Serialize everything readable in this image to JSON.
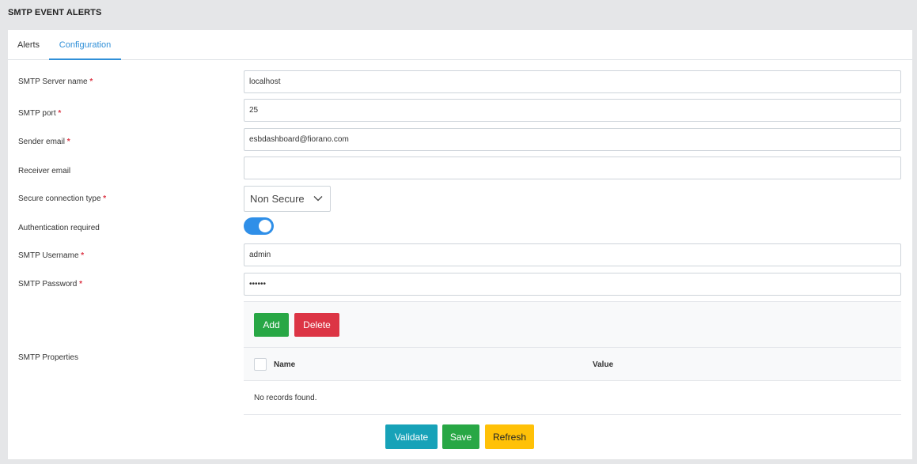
{
  "page": {
    "title": "SMTP EVENT ALERTS"
  },
  "tabs": [
    {
      "label": "Alerts",
      "active": false
    },
    {
      "label": "Configuration",
      "active": true
    }
  ],
  "form": {
    "server_name": {
      "label": "SMTP Server name",
      "value": "localhost",
      "required": true
    },
    "port": {
      "label": "SMTP port",
      "value": "25",
      "required": true
    },
    "sender_email": {
      "label": "Sender email",
      "value": "esbdashboard@fiorano.com",
      "required": true
    },
    "receiver_email": {
      "label": "Receiver email",
      "value": "",
      "required": false
    },
    "secure_connection": {
      "label": "Secure connection type",
      "selected": "Non Secure",
      "required": true
    },
    "auth_required": {
      "label": "Authentication required",
      "enabled": true
    },
    "username": {
      "label": "SMTP Username",
      "value": "admin",
      "required": true
    },
    "password": {
      "label": "SMTP Password",
      "value": "••••••",
      "required": true
    },
    "required_marker": "*"
  },
  "properties": {
    "label": "SMTP Properties",
    "add_label": "Add",
    "delete_label": "Delete",
    "columns": [
      "Name",
      "Value"
    ],
    "empty_message": "No records found."
  },
  "actions": {
    "validate_label": "Validate",
    "save_label": "Save",
    "refresh_label": "Refresh"
  },
  "colors": {
    "accent": "#2f8fd8",
    "success": "#28a745",
    "danger": "#dc3545",
    "info": "#17a2b8",
    "warning": "#ffc107"
  }
}
